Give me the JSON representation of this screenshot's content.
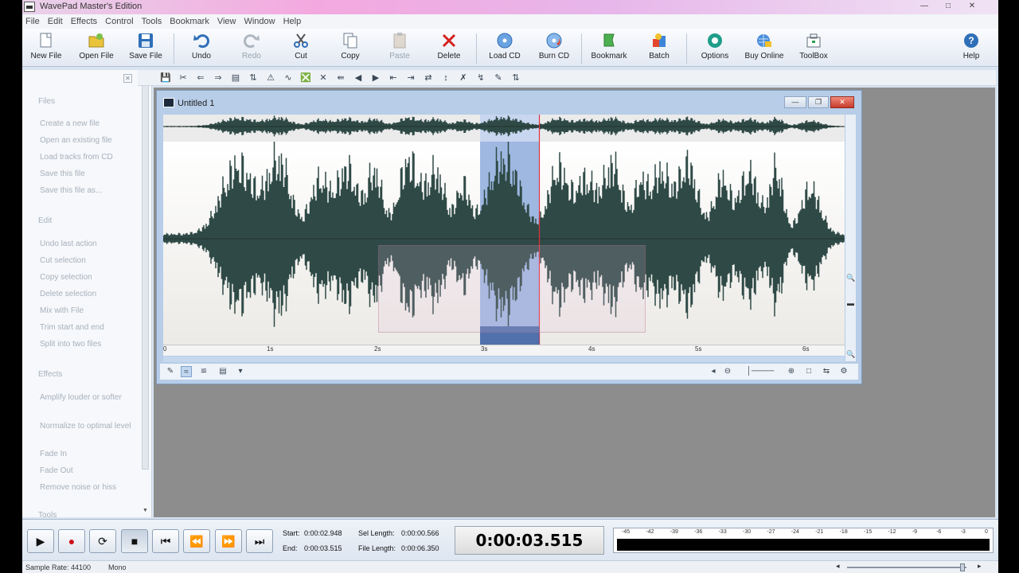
{
  "window": {
    "title": "WavePad Master's Edition"
  },
  "menu": [
    "File",
    "Edit",
    "Effects",
    "Control",
    "Tools",
    "Bookmark",
    "View",
    "Window",
    "Help"
  ],
  "toolbar": {
    "new_file": "New File",
    "open_file": "Open File",
    "save_file": "Save File",
    "undo": "Undo",
    "redo": "Redo",
    "cut": "Cut",
    "copy": "Copy",
    "paste": "Paste",
    "delete": "Delete",
    "load_cd": "Load CD",
    "burn_cd": "Burn CD",
    "bookmark": "Bookmark",
    "batch": "Batch",
    "options": "Options",
    "buy_online": "Buy Online",
    "toolbox": "ToolBox",
    "help": "Help"
  },
  "taskpane": {
    "files_header": "Files",
    "files": [
      "Create a new file",
      "Open an existing file",
      "Load tracks from CD",
      "Save this file",
      "Save this file as..."
    ],
    "edit_header": "Edit",
    "edit": [
      "Undo last action",
      "Cut selection",
      "Copy selection",
      "Delete selection",
      "Mix with File",
      "Trim start and end",
      "Split into two files"
    ],
    "effects_header": "Effects",
    "effects": [
      "Amplify louder or softer",
      "Normalize to optimal level",
      "Fade In",
      "Fade Out",
      "Remove noise or hiss"
    ],
    "tools_header": "Tools"
  },
  "document": {
    "title": "Untitled 1",
    "timeline": [
      "0",
      "1s",
      "2s",
      "3s",
      "4s",
      "5s",
      "6s"
    ],
    "selection_start": 0.465,
    "selection_end": 0.552,
    "playhead": 0.552
  },
  "transport": {
    "start_label": "Start:",
    "start_value": "0:00:02.948",
    "end_label": "End:",
    "end_value": "0:00:03.515",
    "sel_length_label": "Sel Length:",
    "sel_length_value": "0:00:00.566",
    "file_length_label": "File Length:",
    "file_length_value": "0:00:06.350",
    "current_time": "0:00:03.515",
    "meter_scale": [
      "-45",
      "-42",
      "-39",
      "-36",
      "-33",
      "-30",
      "-27",
      "-24",
      "-21",
      "-18",
      "-15",
      "-12",
      "-9",
      "-6",
      "-3",
      "0"
    ]
  },
  "status": {
    "sample_rate": "Sample Rate: 44100",
    "channels": "Mono"
  },
  "colors": {
    "waveform": "#2f4a46",
    "selection": "#9fb8e2",
    "playhead": "#e03040",
    "title_gradient": "#f3a9df"
  }
}
